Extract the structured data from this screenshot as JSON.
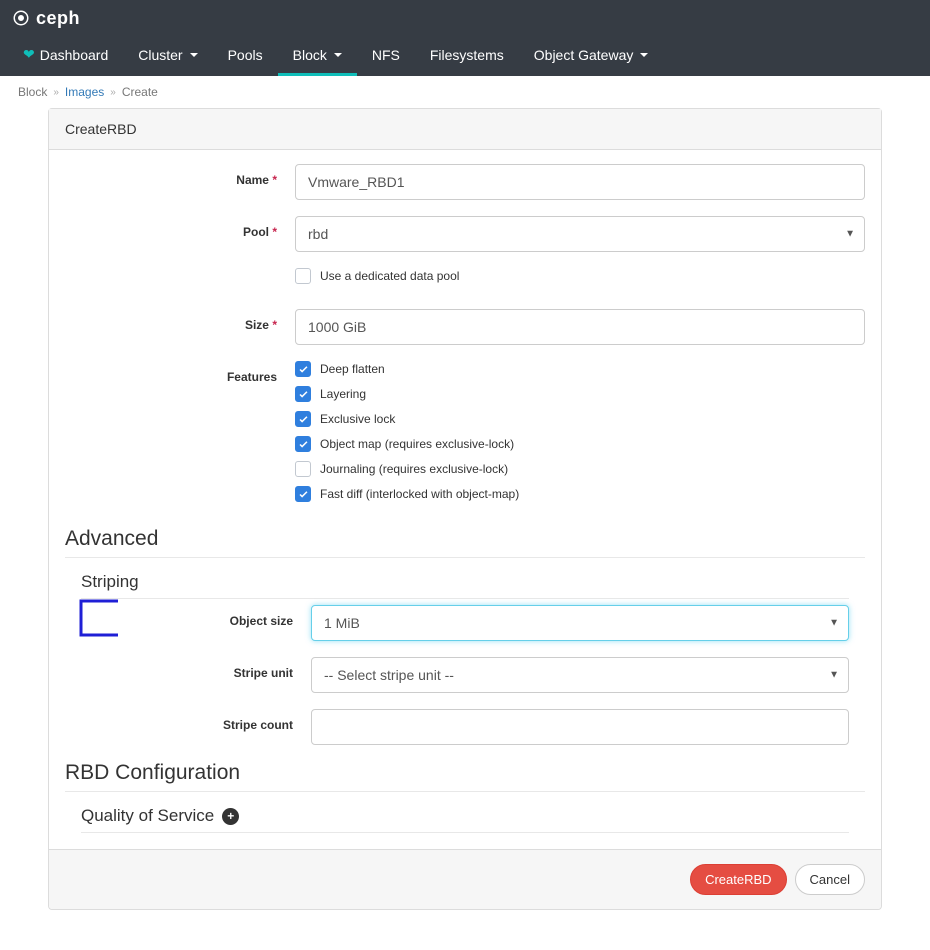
{
  "brand": "ceph",
  "nav": [
    {
      "label": "Dashboard",
      "active": false,
      "caret": false,
      "icon": "heart"
    },
    {
      "label": "Cluster",
      "active": false,
      "caret": true
    },
    {
      "label": "Pools",
      "active": false,
      "caret": false
    },
    {
      "label": "Block",
      "active": true,
      "caret": true
    },
    {
      "label": "NFS",
      "active": false,
      "caret": false
    },
    {
      "label": "Filesystems",
      "active": false,
      "caret": false
    },
    {
      "label": "Object Gateway",
      "active": false,
      "caret": true
    }
  ],
  "breadcrumb": {
    "a": "Block",
    "b": "Images",
    "c": "Create"
  },
  "panel_title": "CreateRBD",
  "labels": {
    "name": "Name",
    "pool": "Pool",
    "dedicated": "Use a dedicated data pool",
    "size": "Size",
    "features": "Features",
    "advanced": "Advanced",
    "striping": "Striping",
    "object_size": "Object size",
    "stripe_unit": "Stripe unit",
    "stripe_count": "Stripe count",
    "rbd_conf": "RBD Configuration",
    "qos": "Quality of Service"
  },
  "values": {
    "name": "Vmware_RBD1",
    "pool": "rbd",
    "size": "1000 GiB",
    "object_size": "1 MiB",
    "stripe_unit_placeholder": "-- Select stripe unit --",
    "stripe_count": ""
  },
  "features": [
    {
      "label": "Deep flatten",
      "checked": true
    },
    {
      "label": "Layering",
      "checked": true
    },
    {
      "label": "Exclusive lock",
      "checked": true
    },
    {
      "label": "Object map (requires exclusive-lock)",
      "checked": true
    },
    {
      "label": "Journaling (requires exclusive-lock)",
      "checked": false
    },
    {
      "label": "Fast diff (interlocked with object-map)",
      "checked": true
    }
  ],
  "buttons": {
    "submit": "CreateRBD",
    "cancel": "Cancel"
  }
}
